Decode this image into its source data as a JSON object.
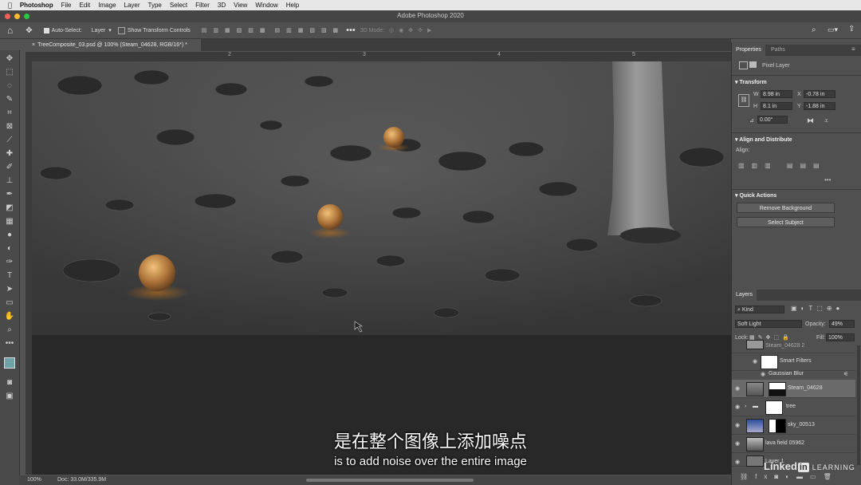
{
  "menubar": {
    "apple": "",
    "items": [
      "Photoshop",
      "File",
      "Edit",
      "Image",
      "Layer",
      "Type",
      "Select",
      "Filter",
      "3D",
      "View",
      "Window",
      "Help"
    ]
  },
  "window": {
    "title": "Adobe Photoshop 2020"
  },
  "options": {
    "auto_select_label": "Auto-Select:",
    "auto_select_value": "Layer",
    "transform_controls_label": "Show Transform Controls",
    "mode_3d_label": "3D Mode:"
  },
  "document": {
    "tab": "TreeComposite_03.psd @ 100% (Steam_04628, RGB/16*) *",
    "ruler_marks": [
      "2",
      "3",
      "4",
      "5"
    ]
  },
  "status": {
    "zoom": "100%",
    "doc": "Doc: 33.0M/335.9M"
  },
  "properties": {
    "tabs": [
      "Properties",
      "Paths"
    ],
    "kind": "Pixel Layer",
    "transform_title": "Transform",
    "w_label": "W",
    "w": "8.98 in",
    "h_label": "H",
    "h": "8.1 in",
    "x_label": "X",
    "x": "-0.78 in",
    "y_label": "Y",
    "y": "-1.88 in",
    "angle": "0.00°",
    "align_title": "Align and Distribute",
    "align_label": "Align:",
    "quick_title": "Quick Actions",
    "remove_bg": "Remove Background",
    "select_subject": "Select Subject"
  },
  "layers": {
    "title": "Layers",
    "filter": "Kind",
    "blend": "Soft Light",
    "opacity_label": "Opacity:",
    "opacity": "49%",
    "lock_label": "Lock:",
    "fill_label": "Fill:",
    "fill": "100%",
    "top_partial": "Steam_04628 2",
    "smart_filters": "Smart Filters",
    "gaussian": "Gaussian Blur",
    "items": [
      "Steam_04628",
      "tree",
      "sky_00513",
      "lava field 05962",
      "Layer 1"
    ]
  },
  "subtitles": {
    "zh": "是在整个图像上添加噪点",
    "en": "is to add noise over the entire image"
  },
  "watermark": {
    "linked": "Linked",
    "in": "in",
    "learning": "LEARNING"
  }
}
